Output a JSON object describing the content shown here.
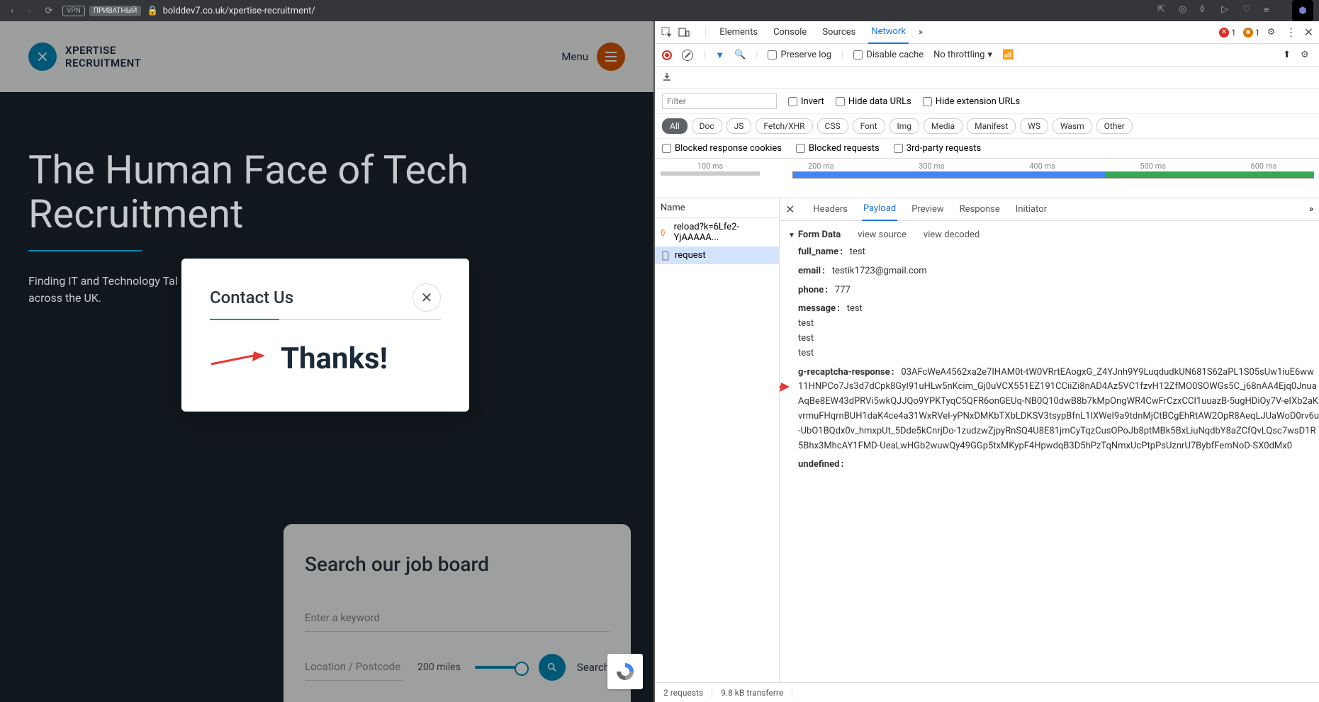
{
  "browser": {
    "vpn": "VPN",
    "private": "ПРИВАТНЫЙ",
    "url": "bolddev7.co.uk/xpertise-recruitment/"
  },
  "site": {
    "logo_line1": "XPERTISE",
    "logo_line2": "RECRUITMENT",
    "menu": "Menu",
    "hero_title": "The Human Face of Tech Recruitment",
    "hero_sub": "Finding IT and Technology Tal\nacross the UK.",
    "search_title": "Search our job board",
    "keyword_placeholder": "Enter a keyword",
    "location_placeholder": "Location / Postcode",
    "miles": "200 miles",
    "search_btn": "Search"
  },
  "modal": {
    "title": "Contact Us",
    "thanks": "Thanks!"
  },
  "devtools": {
    "tabs": {
      "elements": "Elements",
      "console": "Console",
      "sources": "Sources",
      "network": "Network"
    },
    "errors": "1",
    "issues": "1",
    "toolbar": {
      "preserve": "Preserve log",
      "disable_cache": "Disable cache",
      "throttling": "No throttling"
    },
    "filter_placeholder": "Filter",
    "filters": {
      "invert": "Invert",
      "hide_data": "Hide data URLs",
      "hide_ext": "Hide extension URLs"
    },
    "types": [
      "All",
      "Doc",
      "JS",
      "Fetch/XHR",
      "CSS",
      "Font",
      "Img",
      "Media",
      "Manifest",
      "WS",
      "Wasm",
      "Other"
    ],
    "blocks": {
      "cookies": "Blocked response cookies",
      "requests": "Blocked requests",
      "third": "3rd-party requests"
    },
    "timeline_ticks": [
      "100 ms",
      "200 ms",
      "300 ms",
      "400 ms",
      "500 ms",
      "600 ms"
    ],
    "req_col": "Name",
    "requests": [
      {
        "name": "reload?k=6Lfe2-YjAAAAA..."
      },
      {
        "name": "request"
      }
    ],
    "detail_tabs": {
      "headers": "Headers",
      "payload": "Payload",
      "preview": "Preview",
      "response": "Response",
      "initiator": "Initiator"
    },
    "form_data_label": "Form Data",
    "view_source": "view source",
    "view_decoded": "view decoded",
    "payload_rows": [
      {
        "k": "full_name",
        "v": "test"
      },
      {
        "k": "email",
        "v": "testik1723@gmail.com"
      },
      {
        "k": "phone",
        "v": "777"
      },
      {
        "k": "message",
        "v": "test\ntest\ntest\ntest"
      },
      {
        "k": "g-recaptcha-response",
        "v": "03AFcWeA4562xa2e7IHAM0t-tW0VRrtEAogxG_Z4YJnh9Y9LuqdudkUN681S62aPL1S05sUw1iuE6ww11HNPCo7Js3d7dCpk8GyI91uHLw5nKcim_Gj0uVCX551EZ191CCiiZi8nAD4Az5VC1fzvH12ZfMO0SOWGs5C_j68nAA4Ejq0JnuaAqBe8EW43dPRVi5wkQJJQo9YPKTyqC5QFR6onGEUq-NB0Q10dwB8b7kMpOngWR4CwFrCzxCCI1uuazB-5ugHDiOy7V-eIXb2aKvrmuFHqrnBUH1daK4ce4a31WxRVeI-yPNxDMKbTXbLDKSV3tsypBfnL1IXWeI9a9tdnMjCtBCgEhRtAW2OpR8AeqLJUaWoD0rv6u-UbO1BQdx0v_hmxpUt_5Dde5kCnrjDo-1zudzwZjpyRnSQ4U8E81jmCyTqzCusOPoJb8ptMBk5BxLiuNqdbY8aZCfQvLQsc7wsD1R5Bhx3MhcAY1FMD-UeaLwHGb2wuwQy49GGp5txMKypF4HpwdqB3D5hPzTqNmxUcPtpPsUznrU7BybfFemNoD-SX0dMx0"
      },
      {
        "k": "undefined",
        "v": ""
      }
    ],
    "status": {
      "requests": "2 requests",
      "transferred": "9.8 kB transferre"
    }
  }
}
